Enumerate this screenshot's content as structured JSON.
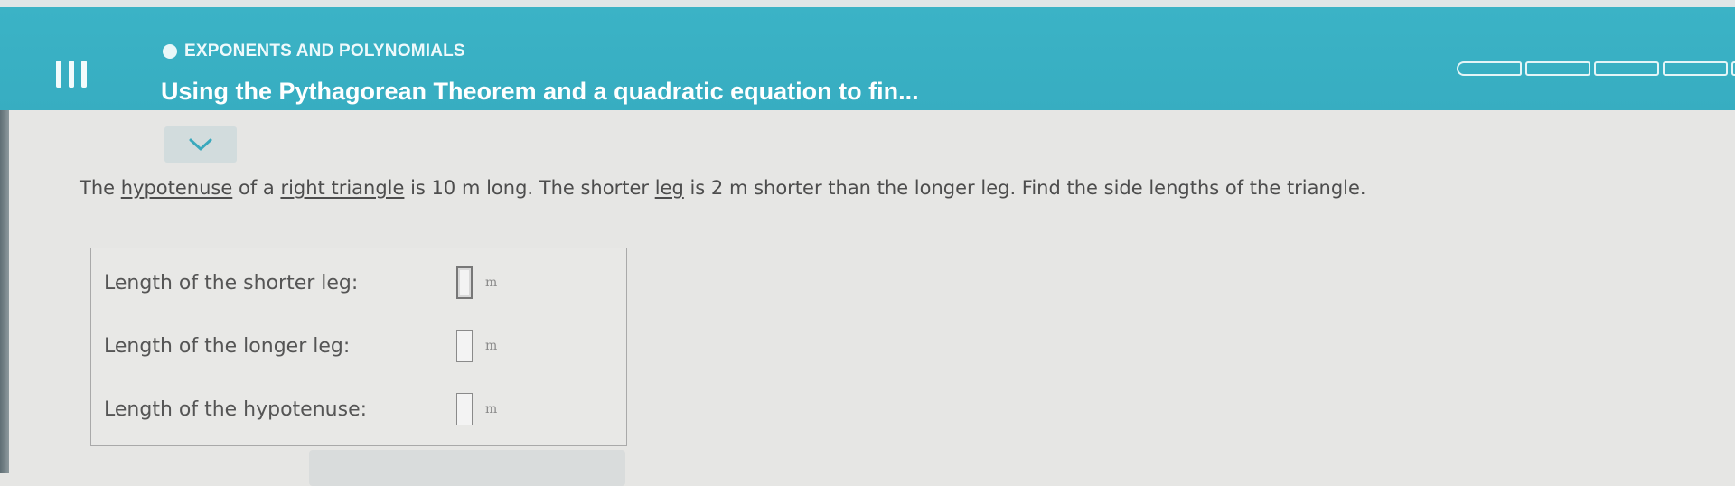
{
  "header": {
    "topic": "EXPONENTS AND POLYNOMIALS",
    "title": "Using the Pythagorean Theorem and a quadratic equation to fin...",
    "progress_segments": 5,
    "colors": {
      "bar": "#3bb3c6",
      "text": "#ffffff"
    },
    "icons": {
      "menu": "menu-icon",
      "topic": "topic-dot-icon"
    }
  },
  "expand": {
    "icon": "chevron-down-icon"
  },
  "problem": {
    "part1": "The ",
    "term1": "hypotenuse",
    "part2": " of a ",
    "term2": "right triangle",
    "part3": " is 10 m long. The shorter ",
    "term3": "leg",
    "part4": " is 2 m shorter than the longer leg. Find the side lengths of the triangle."
  },
  "answers": [
    {
      "label": "Length of the shorter leg:",
      "value": "",
      "unit": "m"
    },
    {
      "label": "Length of the longer leg:",
      "value": "",
      "unit": "m"
    },
    {
      "label": "Length of the hypotenuse:",
      "value": "",
      "unit": "m"
    }
  ]
}
